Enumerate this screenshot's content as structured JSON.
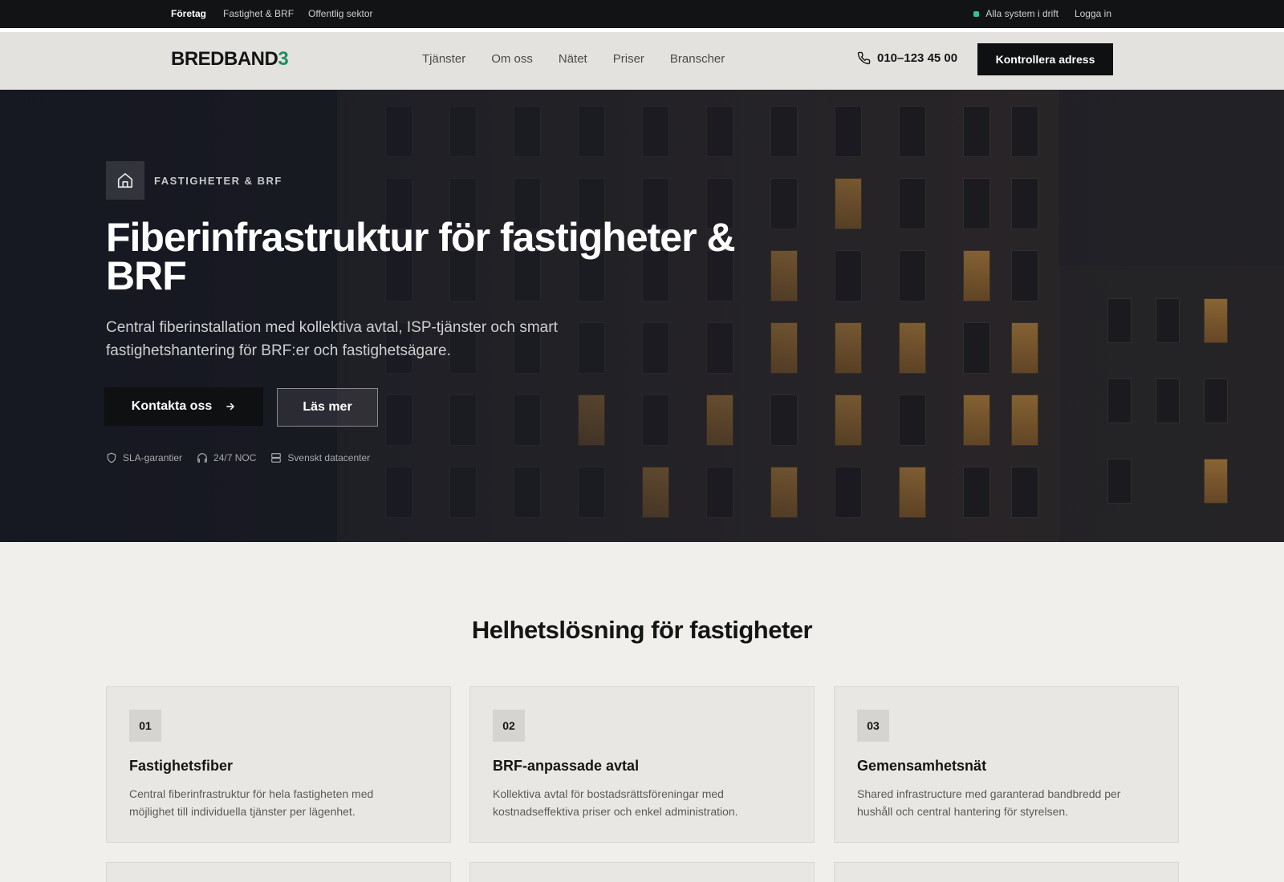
{
  "topbar": {
    "segments": [
      "Företag",
      "Fastighet & BRF",
      "Offentlig sektor"
    ],
    "status": "Alla system i drift",
    "login": "Logga in",
    "status_color": "#2fc58b"
  },
  "header": {
    "logo_main": "BREDBAND",
    "logo_accent": "3",
    "nav": [
      "Tjänster",
      "Om oss",
      "Nätet",
      "Priser",
      "Branscher"
    ],
    "phone": "010–123 45 00",
    "cta": "Kontrollera adress"
  },
  "hero": {
    "tag": "FASTIGHETER & BRF",
    "title": "Fiberinfrastruktur för fastigheter & BRF",
    "subtitle": "Central fiberinstallation med kollektiva avtal, ISP-tjänster och smart fastighetshantering för BRF:er och fastighetsägare.",
    "primary_button": "Kontakta oss",
    "secondary_button": "Läs mer",
    "features": [
      "SLA-garantier",
      "24/7 NOC",
      "Svenskt datacenter"
    ]
  },
  "section": {
    "title": "Helhetslösning för fastigheter",
    "cards": [
      {
        "num": "01",
        "title": "Fastighetsfiber",
        "desc": "Central fiberinfrastruktur för hela fastigheten med möjlighet till individuella tjänster per lägenhet."
      },
      {
        "num": "02",
        "title": "BRF-anpassade avtal",
        "desc": "Kollektiva avtal för bostadsrättsföreningar med kostnadseffektiva priser och enkel administration."
      },
      {
        "num": "03",
        "title": "Gemensamhetsnät",
        "desc": "Shared infrastructure med garanterad bandbredd per hushåll och central hantering för styrelsen."
      }
    ]
  },
  "colors": {
    "accent": "#1f8d5e",
    "dark": "#0f1011",
    "background": "#f0efeb"
  }
}
